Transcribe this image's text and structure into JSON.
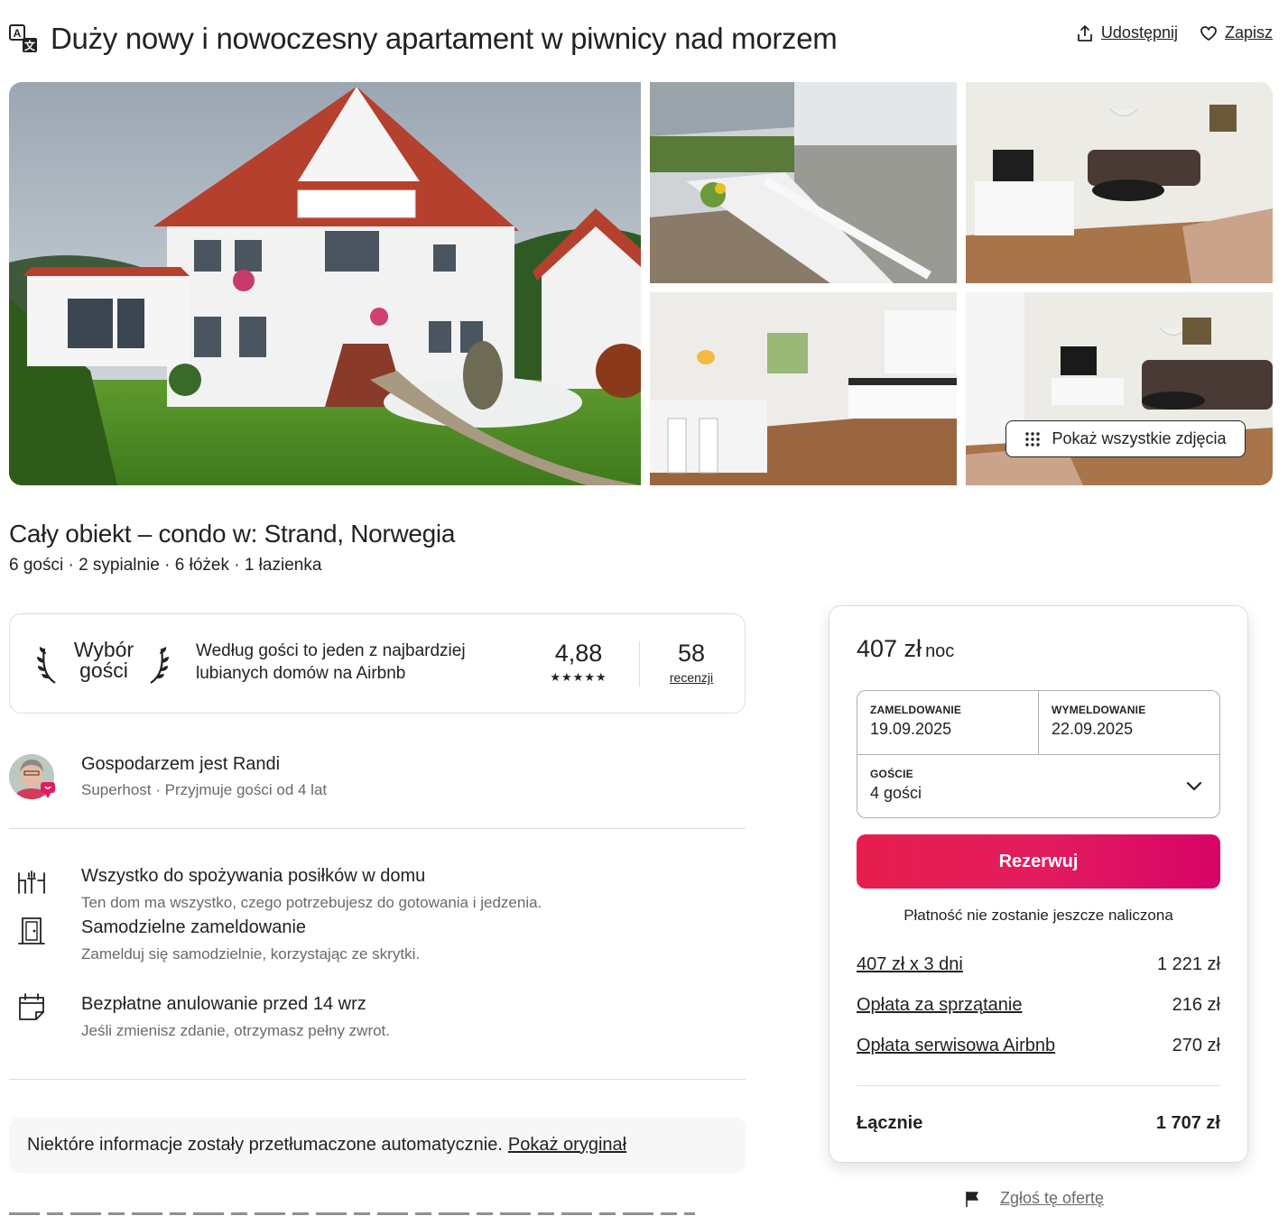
{
  "header": {
    "title": "Duży nowy i nowoczesny apartament w piwnicy nad morzem",
    "share_label": "Udostępnij",
    "save_label": "Zapisz"
  },
  "gallery": {
    "show_all_label": "Pokaż wszystkie zdjęcia",
    "photos": [
      "house-exterior",
      "balcony-terrace",
      "living-room-tv",
      "kitchen-dining",
      "living-room-sofa"
    ]
  },
  "listing": {
    "subtitle": "Cały obiekt – condo w: Strand, Norwegia",
    "details": "6 gości · 2 sypialnie · 6 łóżek · 1 łazienka"
  },
  "guest_favorite": {
    "title_line1": "Wybór",
    "title_line2": "gości",
    "text": "Według gości to jeden z najbardziej lubianych domów na Airbnb",
    "rating": "4,88",
    "stars": "★★★★★",
    "stars_count": 5,
    "reviews_count": "58",
    "reviews_label": "recenzji"
  },
  "host": {
    "name": "Gospodarzem jest Randi",
    "meta": "Superhost · Przyjmuje gości od 4 lat"
  },
  "highlights": [
    {
      "icon": "dining-icon",
      "title": "Wszystko do spożywania posiłków w domu",
      "desc": "Ten dom ma wszystko, czego potrzebujesz do gotowania i jedzenia."
    },
    {
      "icon": "door-icon",
      "title": "Samodzielne zameldowanie",
      "desc": "Zamelduj się samodzielnie, korzystając ze skrytki."
    },
    {
      "icon": "calendar-icon",
      "title": "Bezpłatne anulowanie przed 14 wrz",
      "desc": "Jeśli zmienisz zdanie, otrzymasz pełny zwrot."
    }
  ],
  "notice": {
    "text": "Niektóre informacje zostały przetłumaczone automatycznie.",
    "link": "Pokaż oryginał"
  },
  "booking": {
    "price": "407 zł",
    "price_unit": "noc",
    "checkin_label": "ZAMELDOWANIE",
    "checkin_value": "19.09.2025",
    "checkout_label": "WYMELDOWANIE",
    "checkout_value": "22.09.2025",
    "guests_label": "GOŚCIE",
    "guests_value": "4 gości",
    "reserve_label": "Rezerwuj",
    "no_charge": "Płatność nie zostanie jeszcze naliczona",
    "fees": [
      {
        "label": "407 zł x 3 dni",
        "value": "1 221 zł"
      },
      {
        "label": "Opłata za sprzątanie",
        "value": "216 zł"
      },
      {
        "label": "Opłata serwisowa Airbnb",
        "value": "270 zł"
      }
    ],
    "total_label": "Łącznie",
    "total_value": "1 707 zł"
  },
  "report_label": "Zgłoś tę ofertę",
  "colors": {
    "accent": "#E31C5F",
    "text": "#222222",
    "muted": "#6A6A6A",
    "border": "#DDDDDD"
  }
}
